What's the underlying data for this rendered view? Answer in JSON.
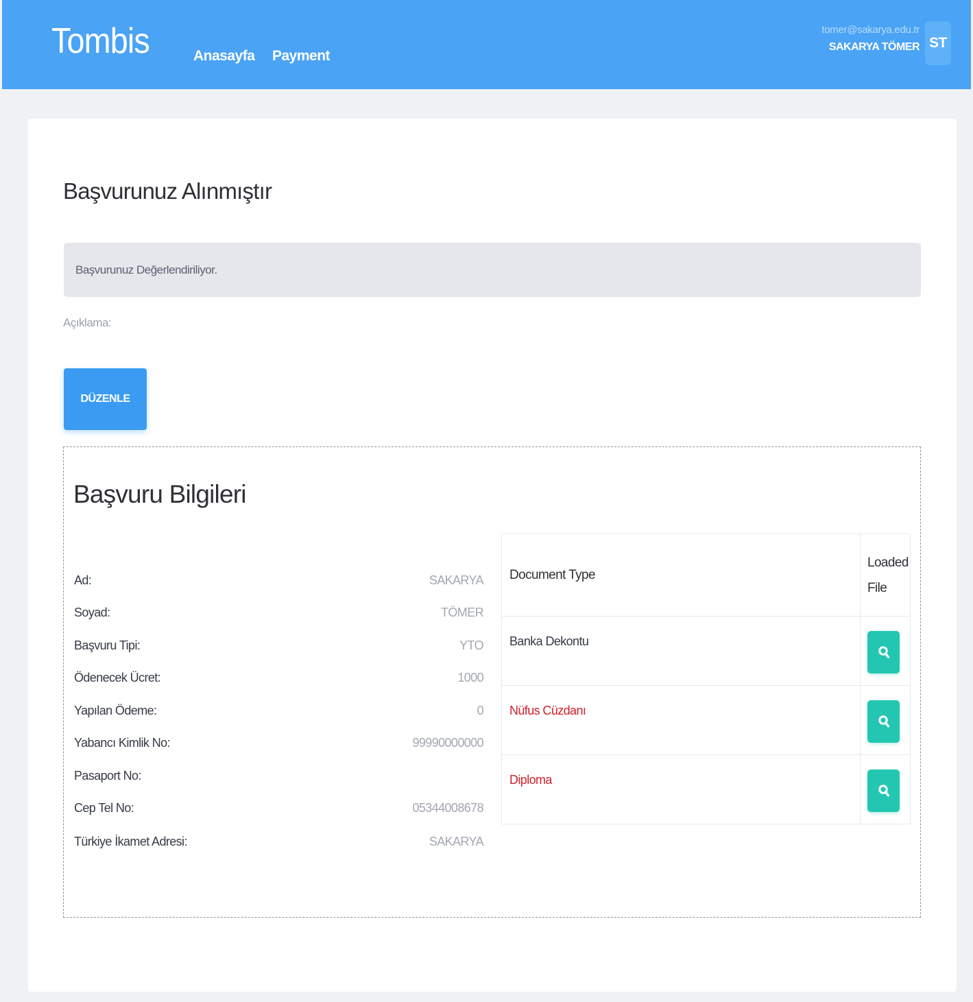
{
  "header": {
    "brand": "Tombis",
    "nav": [
      {
        "label": "Anasayfa"
      },
      {
        "label": "Payment"
      }
    ],
    "user": {
      "email": "tomer@sakarya.edu.tr",
      "name": "SAKARYA TÖMER",
      "initials": "ST"
    }
  },
  "main": {
    "title": "Başvurunuz Alınmıştır",
    "status_text": "Başvurunuz Değerlendiriliyor.",
    "description_label": "Açıklama:",
    "edit_button_label": "DÜZENLE"
  },
  "application": {
    "title": "Başvuru Bilgileri",
    "fields": [
      {
        "label": "Ad:",
        "value": "SAKARYA"
      },
      {
        "label": "Soyad:",
        "value": "TÖMER"
      },
      {
        "label": "Başvuru Tipi:",
        "value": "YTO"
      },
      {
        "label": "Ödenecek Ücret:",
        "value": "1000"
      },
      {
        "label": "Yapılan Ödeme:",
        "value": "0"
      },
      {
        "label": "Yabancı Kimlik No:",
        "value": "99990000000"
      },
      {
        "label": "Pasaport No:",
        "value": ""
      },
      {
        "label": "Cep Tel No:",
        "value": "05344008678"
      },
      {
        "label": "Türkiye İkamet Adresi:",
        "value": "SAKARYA"
      }
    ],
    "documents": {
      "headers": {
        "type": "Document Type",
        "file_line1": "Loaded",
        "file_line2": "File"
      },
      "rows": [
        {
          "type": "Banka Dekontu",
          "status_color": "#353a45",
          "icon": "search-icon"
        },
        {
          "type": "Nüfus Cüzdanı",
          "status_color": "#d0212b",
          "icon": "search-icon"
        },
        {
          "type": "Diploma",
          "status_color": "#d0212b",
          "icon": "search-icon"
        }
      ]
    }
  },
  "colors": {
    "header_bg": "#4aa3f5",
    "primary_button": "#3b9bf2",
    "view_button": "#23c7b1",
    "missing_document": "#d0212b"
  }
}
